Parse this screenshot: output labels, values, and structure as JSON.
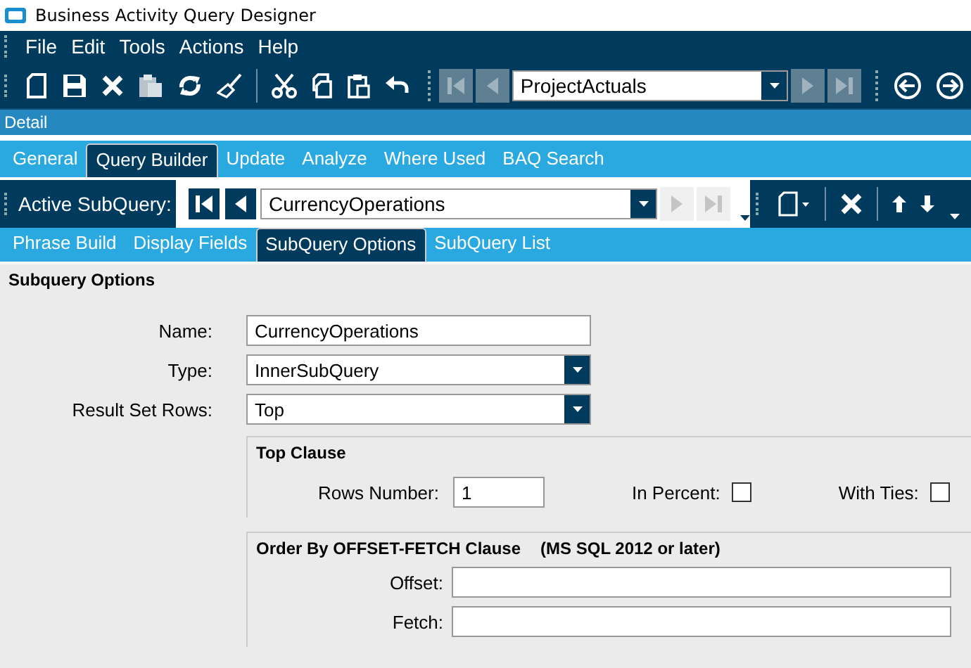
{
  "window": {
    "title": "Business Activity Query Designer"
  },
  "menu": [
    "File",
    "Edit",
    "Tools",
    "Actions",
    "Help"
  ],
  "toolbar": {
    "query_selector": {
      "value": "ProjectActuals"
    }
  },
  "section": "Detail",
  "tabs": [
    {
      "label": "General",
      "selected": false
    },
    {
      "label": "Query Builder",
      "selected": true
    },
    {
      "label": "Update",
      "selected": false
    },
    {
      "label": "Analyze",
      "selected": false
    },
    {
      "label": "Where Used",
      "selected": false
    },
    {
      "label": "BAQ Search",
      "selected": false
    }
  ],
  "subquery_bar": {
    "label": "Active SubQuery:",
    "value": "CurrencyOperations"
  },
  "subtabs": [
    {
      "label": "Phrase Build",
      "selected": false
    },
    {
      "label": "Display Fields",
      "selected": false
    },
    {
      "label": "SubQuery Options",
      "selected": true
    },
    {
      "label": "SubQuery List",
      "selected": false
    }
  ],
  "panel": {
    "title": "Subquery Options",
    "fields": [
      {
        "label": "Name:",
        "value": "CurrencyOperations",
        "kind": "text"
      },
      {
        "label": "Type:",
        "value": "InnerSubQuery",
        "kind": "dropdown"
      },
      {
        "label": "Result Set Rows:",
        "value": "Top",
        "kind": "dropdown"
      }
    ],
    "top_clause": {
      "title": "Top Clause",
      "rows_number": {
        "label": "Rows Number:",
        "value": "1"
      },
      "in_percent": {
        "label": "In Percent:",
        "checked": false
      },
      "with_ties": {
        "label": "With Ties:",
        "checked": false
      }
    },
    "order_by": {
      "title": "Order By OFFSET-FETCH Clause",
      "note": "(MS SQL 2012 or later)",
      "offset": {
        "label": "Offset:"
      },
      "fetch": {
        "label": "Fetch:"
      }
    }
  }
}
